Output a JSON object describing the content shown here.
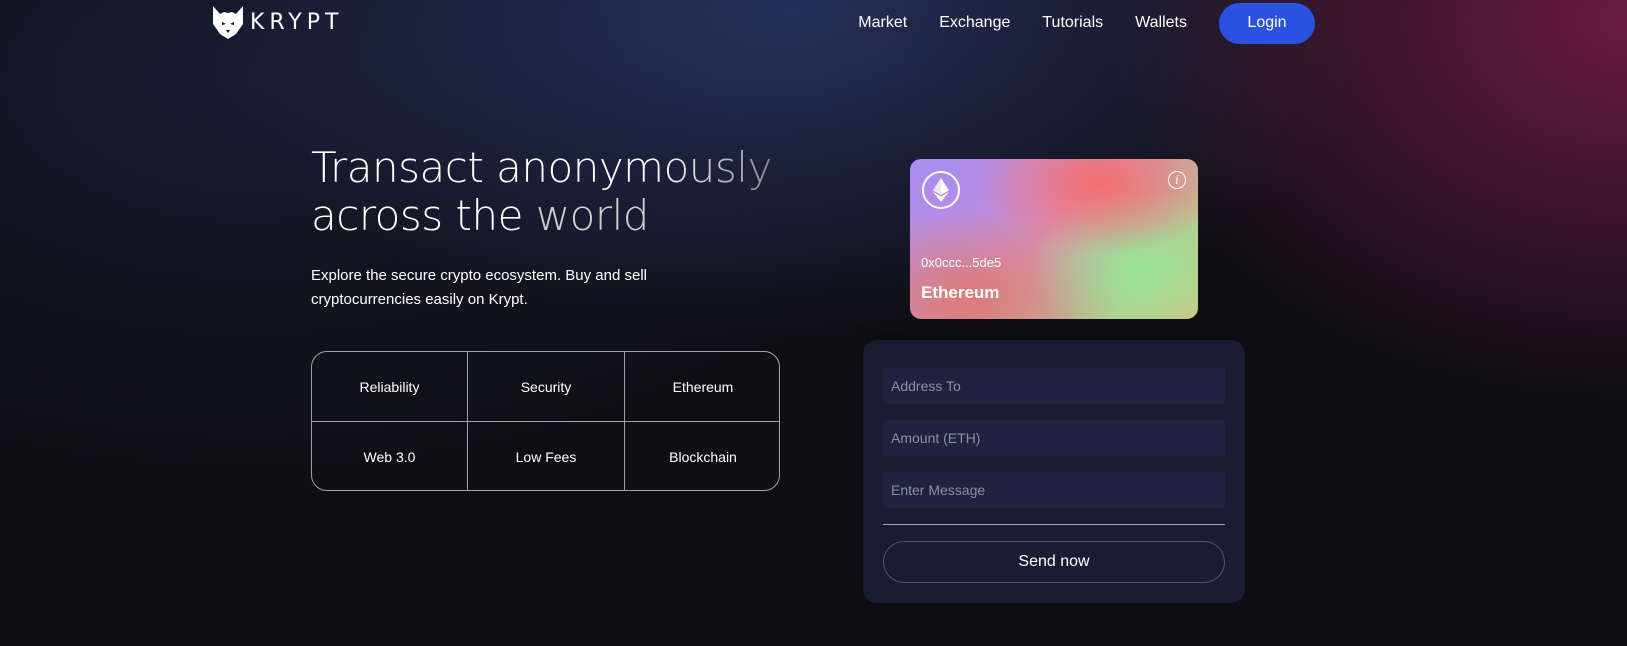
{
  "nav": {
    "logo_text": "KRYPT",
    "links": [
      "Market",
      "Exchange",
      "Tutorials",
      "Wallets"
    ],
    "login_label": "Login"
  },
  "hero": {
    "title_line1_plain": "Transact ano",
    "title_line1_fade": "nymously",
    "title_line2_plain": "across the ",
    "title_line2_fade": "world",
    "subtitle": "Explore the secure crypto ecosystem. Buy and sell cryptocurrencies easily on Krypt."
  },
  "features": [
    "Reliability",
    "Security",
    "Ethereum",
    "Web 3.0",
    "Low Fees",
    "Blockchain"
  ],
  "card": {
    "address": "0x0ccc...5de5",
    "network": "Ethereum",
    "info_glyph": "i",
    "icons": [
      "ethereum-icon",
      "info-icon"
    ]
  },
  "form": {
    "address_placeholder": "Address To",
    "amount_placeholder": "Amount (ETH)",
    "message_placeholder": "Enter Message",
    "send_label": "Send now"
  },
  "colors": {
    "background": "#0f0e13",
    "accent": "#2952e3",
    "panel": "#1b1e34",
    "input": "#1f2340",
    "border": "#9ca3af"
  }
}
